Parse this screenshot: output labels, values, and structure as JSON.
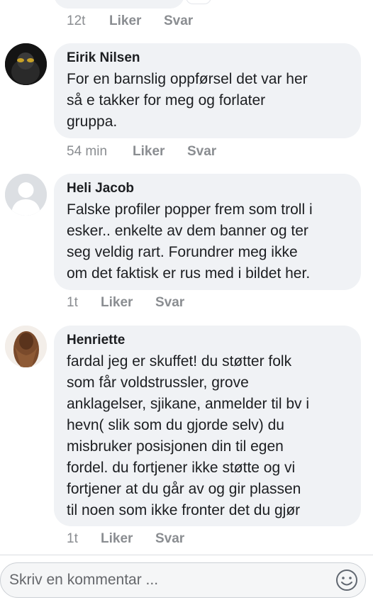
{
  "top_fragment": {
    "time": "12t",
    "like": "Liker",
    "reply": "Svar"
  },
  "comments": [
    {
      "author": "Eirik Nilsen",
      "text": "For en barnslig oppførsel det var her\nså e takker for meg og forlater\ngruppa.",
      "time": "54 min",
      "like": "Liker",
      "reply": "Svar"
    },
    {
      "author": "Heli Jacob",
      "text": "Falske profiler popper frem som troll i\nesker.. enkelte av dem banner og ter\nseg veldig rart. Forundrer meg ikke\nom det faktisk er rus med i bildet her.",
      "time": "1t",
      "like": "Liker",
      "reply": "Svar"
    },
    {
      "author": "Henriette",
      "text": "fardal jeg er skuffet! du støtter folk\nsom får voldstrussler, grove\nanklagelser, sjikane, anmelder til bv i\nhevn( slik som du gjorde selv)  du\nmisbruker posisjonen din til egen\nfordel. du fortjener ikke støtte og vi\nfortjener at du går av og gir plassen\ntil noen som ikke fronter det du gjør",
      "time": "1t",
      "like": "Liker",
      "reply": "Svar"
    }
  ],
  "composer": {
    "placeholder": "Skriv en kommentar ...",
    "emoji_icon": "smiley-icon"
  },
  "colors": {
    "bubble": "#f0f2f5",
    "meta": "#8a8d91",
    "text": "#1c1e21"
  }
}
